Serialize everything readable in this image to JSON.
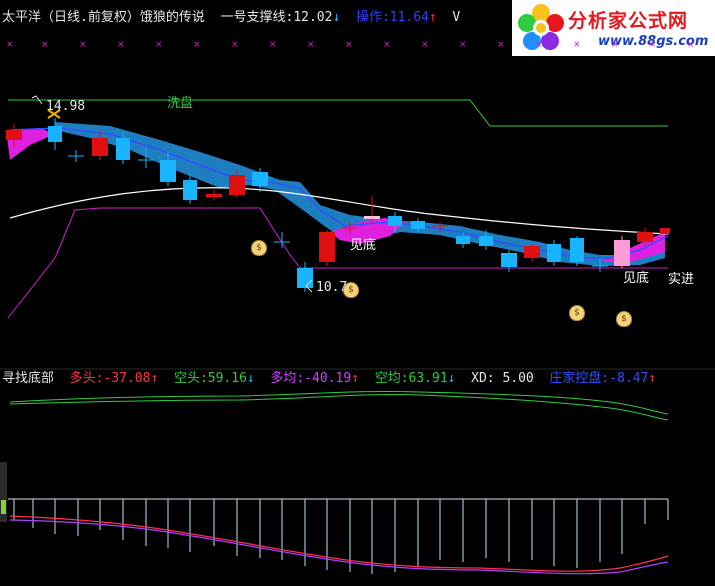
{
  "header": {
    "name": "太平洋（日线.前复权）",
    "indicator_name": "饿狼的传说",
    "support_label": "一号支撑线:",
    "support_value": "12.02",
    "support_arrow": "↓",
    "operation_label": "操作:",
    "operation_value": "11.64",
    "operation_arrow": "↑",
    "trailing": "V"
  },
  "logo": {
    "text": "分析家公式网",
    "url_text": "www.88gs.com"
  },
  "main_chart": {
    "high_label": "14.98",
    "low_label": "10.7",
    "text_xipan": "洗盘",
    "text_jiandi_1": "见底",
    "text_jiandi_2": "见底",
    "text_shijin": "实进",
    "bag_glyph": "$"
  },
  "sub_header": {
    "title": "寻找底部",
    "duotou_label": "多头:",
    "duotou_value": "-37.08",
    "duotou_arrow": "↑",
    "kongtou_label": "空头:",
    "kongtou_value": "59.16",
    "kongtou_arrow": "↓",
    "duojun_label": "多均:",
    "duojun_value": "-40.19",
    "duojun_arrow": "↑",
    "kongjun_label": "空均:",
    "kongjun_value": "63.91",
    "kongjun_arrow": "↓",
    "xd_label": "XD:",
    "xd_value": "5.00",
    "zhuangjia_label": "庄家控盘:",
    "zhuangjia_value": "-8.47",
    "zhuangjia_arrow": "↑"
  },
  "colors": {
    "background": "#000000",
    "up_candle": "#19b4ff",
    "down_candle": "#e01010",
    "band_blue": "#1e7fc0",
    "band_magenta": "#e020e0",
    "green_line": "#2ecc40",
    "white_line": "#ffffff",
    "accent_red": "#ff3030"
  },
  "icons": [
    "money-bag-icon",
    "cross-marker-icon",
    "x-marker-icon"
  ]
}
